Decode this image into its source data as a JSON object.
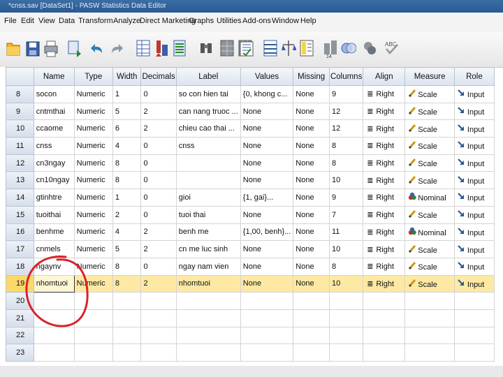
{
  "window": {
    "title": "*cnss.sav [DataSet1] - PASW Statistics Data Editor"
  },
  "menu": [
    "File",
    "Edit",
    "View",
    "Data",
    "Transform",
    "Analyze",
    "Direct Marketing",
    "Graphs",
    "Utilities",
    "Add-ons",
    "Window",
    "Help"
  ],
  "toolbar": {
    "icons": [
      "open-folder-icon",
      "save-icon",
      "print-icon",
      "dialog-recall-icon",
      "undo-icon",
      "redo-icon",
      "goto-case-icon",
      "goto-variable-icon",
      "variables-icon",
      "find-icon",
      "insert-cases-icon",
      "insert-variable-icon",
      "split-file-icon",
      "weight-cases-icon",
      "select-cases-icon",
      "value-labels-icon",
      "use-sets-icon",
      "show-all-variables-icon",
      "spelling-icon"
    ]
  },
  "grid": {
    "columns": [
      "Name",
      "Type",
      "Width",
      "Decimals",
      "Label",
      "Values",
      "Missing",
      "Columns",
      "Align",
      "Measure",
      "Role"
    ],
    "rows": [
      {
        "n": "8",
        "name": "socon",
        "type": "Numeric",
        "width": "1",
        "dec": "0",
        "label": "so con hien tai",
        "values": "{0, khong c...",
        "missing": "None",
        "columns": "9",
        "align": "Right",
        "measure": "Scale",
        "role": "Input"
      },
      {
        "n": "9",
        "name": "cntmthai",
        "type": "Numeric",
        "width": "5",
        "dec": "2",
        "label": "can nang truoc ...",
        "values": "None",
        "missing": "None",
        "columns": "12",
        "align": "Right",
        "measure": "Scale",
        "role": "Input"
      },
      {
        "n": "10",
        "name": "ccaome",
        "type": "Numeric",
        "width": "6",
        "dec": "2",
        "label": "chieu cao thai ...",
        "values": "None",
        "missing": "None",
        "columns": "12",
        "align": "Right",
        "measure": "Scale",
        "role": "Input"
      },
      {
        "n": "11",
        "name": "cnss",
        "type": "Numeric",
        "width": "4",
        "dec": "0",
        "label": "cnss",
        "values": "None",
        "missing": "None",
        "columns": "8",
        "align": "Right",
        "measure": "Scale",
        "role": "Input"
      },
      {
        "n": "12",
        "name": "cn3ngay",
        "type": "Numeric",
        "width": "8",
        "dec": "0",
        "label": "",
        "values": "None",
        "missing": "None",
        "columns": "8",
        "align": "Right",
        "measure": "Scale",
        "role": "Input"
      },
      {
        "n": "13",
        "name": "cn10ngay",
        "type": "Numeric",
        "width": "8",
        "dec": "0",
        "label": "",
        "values": "None",
        "missing": "None",
        "columns": "10",
        "align": "Right",
        "measure": "Scale",
        "role": "Input"
      },
      {
        "n": "14",
        "name": "gtinhtre",
        "type": "Numeric",
        "width": "1",
        "dec": "0",
        "label": "gioi",
        "values": "{1, gai}...",
        "missing": "None",
        "columns": "9",
        "align": "Right",
        "measure": "Nominal",
        "role": "Input"
      },
      {
        "n": "15",
        "name": "tuoithai",
        "type": "Numeric",
        "width": "2",
        "dec": "0",
        "label": "tuoi thai",
        "values": "None",
        "missing": "None",
        "columns": "7",
        "align": "Right",
        "measure": "Scale",
        "role": "Input"
      },
      {
        "n": "16",
        "name": "benhme",
        "type": "Numeric",
        "width": "4",
        "dec": "2",
        "label": "benh me",
        "values": "{1,00, benh}...",
        "missing": "None",
        "columns": "11",
        "align": "Right",
        "measure": "Nominal",
        "role": "Input"
      },
      {
        "n": "17",
        "name": "cnmels",
        "type": "Numeric",
        "width": "5",
        "dec": "2",
        "label": "cn me luc sinh",
        "values": "None",
        "missing": "None",
        "columns": "10",
        "align": "Right",
        "measure": "Scale",
        "role": "Input"
      },
      {
        "n": "18",
        "name": "ngaynv",
        "type": "Numeric",
        "width": "8",
        "dec": "0",
        "label": "ngay nam vien",
        "values": "None",
        "missing": "None",
        "columns": "8",
        "align": "Right",
        "measure": "Scale",
        "role": "Input"
      },
      {
        "n": "19",
        "name": "nhomtuoi",
        "type": "Numeric",
        "width": "8",
        "dec": "2",
        "label": "nhomtuoi",
        "values": "None",
        "missing": "None",
        "columns": "10",
        "align": "Right",
        "measure": "Scale",
        "role": "Input"
      },
      {
        "n": "20",
        "name": "",
        "type": "",
        "width": "",
        "dec": "",
        "label": "",
        "values": "",
        "missing": "",
        "columns": "",
        "align": "",
        "measure": "",
        "role": ""
      },
      {
        "n": "21",
        "name": "",
        "type": "",
        "width": "",
        "dec": "",
        "label": "",
        "values": "",
        "missing": "",
        "columns": "",
        "align": "",
        "measure": "",
        "role": ""
      },
      {
        "n": "22",
        "name": "",
        "type": "",
        "width": "",
        "dec": "",
        "label": "",
        "values": "",
        "missing": "",
        "columns": "",
        "align": "",
        "measure": "",
        "role": ""
      },
      {
        "n": "23",
        "name": "",
        "type": "",
        "width": "",
        "dec": "",
        "label": "",
        "values": "",
        "missing": "",
        "columns": "",
        "align": "",
        "measure": "",
        "role": ""
      }
    ],
    "selected_row": "19",
    "annotation_color": "#d9232b"
  }
}
